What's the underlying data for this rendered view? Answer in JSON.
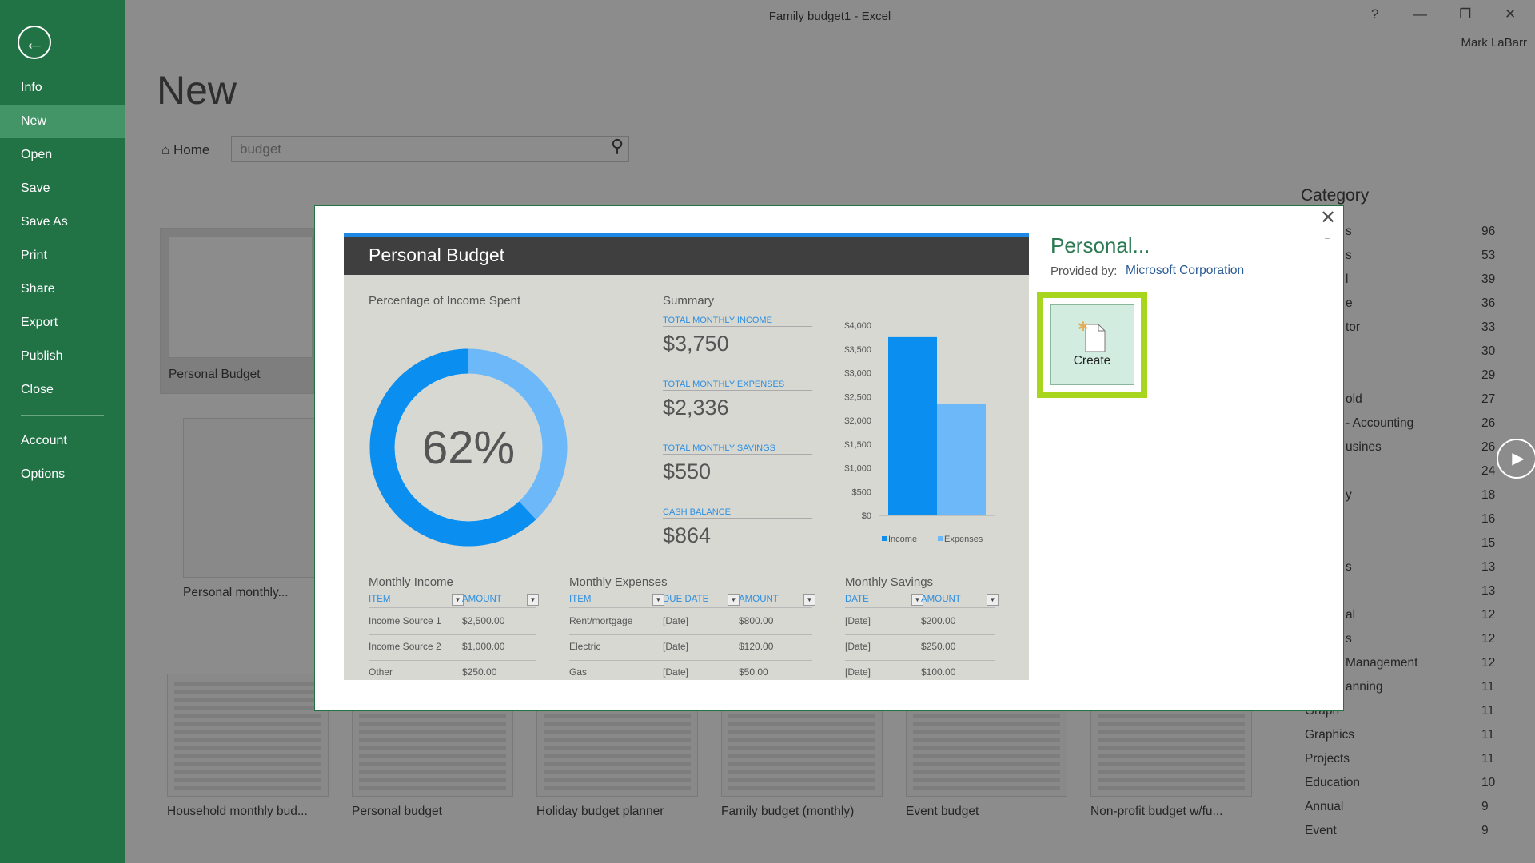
{
  "window": {
    "title": "Family budget1 - Excel",
    "user": "Mark LaBarr",
    "help": "?",
    "minimize": "—",
    "restore": "❐",
    "close": "✕"
  },
  "sidebar": {
    "back_icon": "←",
    "items": [
      {
        "label": "Info"
      },
      {
        "label": "New",
        "active": true
      },
      {
        "label": "Open"
      },
      {
        "label": "Save"
      },
      {
        "label": "Save As"
      },
      {
        "label": "Print"
      },
      {
        "label": "Share"
      },
      {
        "label": "Export"
      },
      {
        "label": "Publish"
      },
      {
        "label": "Close"
      },
      {
        "label": "Account"
      },
      {
        "label": "Options"
      }
    ]
  },
  "main": {
    "heading": "New",
    "home_label": "Home",
    "home_icon": "⌂",
    "search_value": "budget",
    "search_icon": "⚲"
  },
  "category": {
    "heading": "Category",
    "items": [
      {
        "name": "s",
        "count": "96"
      },
      {
        "name": "s",
        "count": "53"
      },
      {
        "name": "l",
        "count": "39"
      },
      {
        "name": "e",
        "count": "36"
      },
      {
        "name": "tor",
        "count": "33"
      },
      {
        "name": "",
        "count": "30"
      },
      {
        "name": "",
        "count": "29"
      },
      {
        "name": "old",
        "count": "27"
      },
      {
        "name": " - Accounting",
        "count": "26"
      },
      {
        "name": "usines",
        "count": "26"
      },
      {
        "name": "",
        "count": "24"
      },
      {
        "name": "y",
        "count": "18"
      },
      {
        "name": "",
        "count": "16"
      },
      {
        "name": "",
        "count": "15"
      },
      {
        "name": "s",
        "count": "13"
      },
      {
        "name": "",
        "count": "13"
      },
      {
        "name": "al",
        "count": "12"
      },
      {
        "name": "s",
        "count": "12"
      },
      {
        "name": "Management",
        "count": "12"
      },
      {
        "name": "anning",
        "count": "11"
      },
      {
        "name": "Graph",
        "count": "11"
      },
      {
        "name": "Graphics",
        "count": "11"
      },
      {
        "name": "Projects",
        "count": "11"
      },
      {
        "name": "Education",
        "count": "10"
      },
      {
        "name": "Annual",
        "count": "9"
      },
      {
        "name": "Event",
        "count": "9"
      }
    ]
  },
  "templates": {
    "left": [
      {
        "label": "Personal Budget"
      },
      {
        "label": "Personal monthly..."
      }
    ],
    "bottom": [
      {
        "label": "Household monthly bud..."
      },
      {
        "label": "Personal budget"
      },
      {
        "label": "Holiday budget planner"
      },
      {
        "label": "Family budget (monthly)"
      },
      {
        "label": "Event budget"
      },
      {
        "label": "Non-profit budget w/fu..."
      }
    ]
  },
  "dialog": {
    "title": "Personal...",
    "provided_by_label": "Provided by:",
    "provider": "Microsoft Corporation",
    "create_label": "Create",
    "close_icon": "✕",
    "pin_icon": "⊣",
    "play_icon": "▶",
    "preview": {
      "title": "Personal Budget",
      "pct_heading": "Percentage of Income Spent",
      "pct_value": "62%",
      "pct_fraction": 0.62,
      "colors": {
        "primary": "#0a8ff0",
        "secondary": "#6cb8f8"
      },
      "summary_heading": "Summary",
      "summary": [
        {
          "label": "TOTAL MONTHLY INCOME",
          "value": "$3,750"
        },
        {
          "label": "TOTAL MONTHLY EXPENSES",
          "value": "$2,336"
        },
        {
          "label": "TOTAL MONTHLY SAVINGS",
          "value": "$550"
        },
        {
          "label": "CASH BALANCE",
          "value": "$864"
        }
      ],
      "chart_data": {
        "type": "bar",
        "categories": [
          "Income",
          "Expenses"
        ],
        "values": [
          3750,
          2336
        ],
        "ylim": [
          0,
          4000
        ],
        "yticks": [
          "$4,000",
          "$3,500",
          "$3,000",
          "$2,500",
          "$2,000",
          "$1,500",
          "$1,000",
          "$500",
          "$0"
        ],
        "legend": [
          "Income",
          "Expenses"
        ],
        "legend_position": "bottom"
      },
      "income": {
        "heading": "Monthly Income",
        "headers": [
          "ITEM",
          "AMOUNT"
        ],
        "rows": [
          [
            "Income Source 1",
            "$2,500.00"
          ],
          [
            "Income Source 2",
            "$1,000.00"
          ],
          [
            "Other",
            "$250.00"
          ]
        ]
      },
      "expenses": {
        "heading": "Monthly Expenses",
        "headers": [
          "ITEM",
          "DUE DATE",
          "AMOUNT"
        ],
        "rows": [
          [
            "Rent/mortgage",
            "[Date]",
            "$800.00"
          ],
          [
            "Electric",
            "[Date]",
            "$120.00"
          ],
          [
            "Gas",
            "[Date]",
            "$50.00"
          ]
        ]
      },
      "savings": {
        "heading": "Monthly Savings",
        "headers": [
          "DATE",
          "AMOUNT"
        ],
        "rows": [
          [
            "[Date]",
            "$200.00"
          ],
          [
            "[Date]",
            "$250.00"
          ],
          [
            "[Date]",
            "$100.00"
          ]
        ]
      }
    }
  }
}
